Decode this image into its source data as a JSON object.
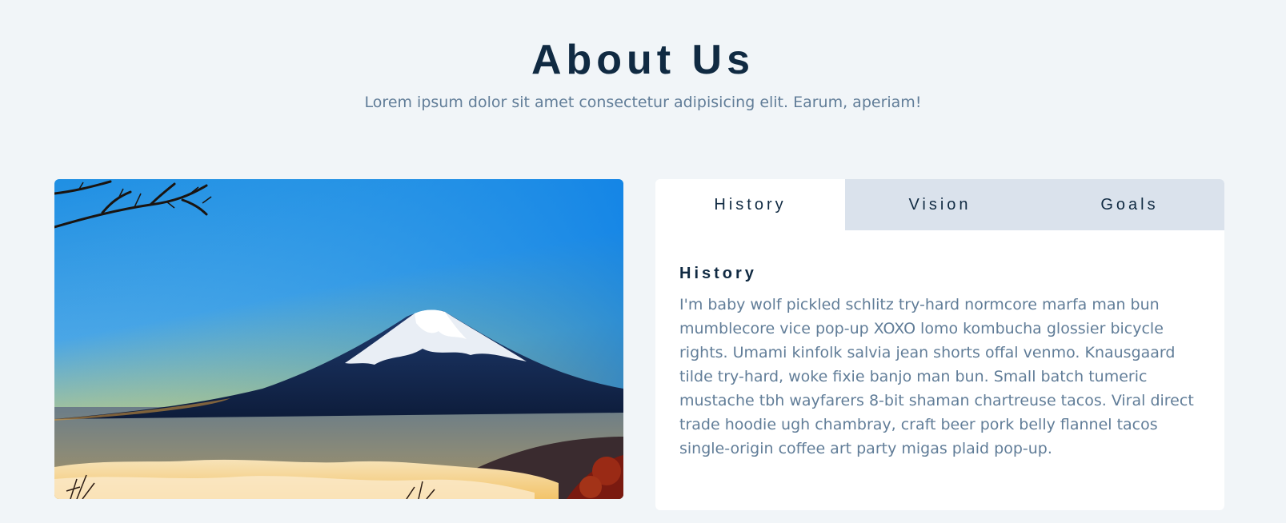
{
  "header": {
    "title": "About Us",
    "subtitle": "Lorem ipsum dolor sit amet consectetur adipisicing elit. Earum, aperiam!"
  },
  "image": {
    "alt_icon": "mountain-landscape-image"
  },
  "tabs": [
    {
      "label": "History",
      "active": true
    },
    {
      "label": "Vision",
      "active": false
    },
    {
      "label": "Goals",
      "active": false
    }
  ],
  "content": {
    "title": "History",
    "text": "I'm baby wolf pickled schlitz try-hard normcore marfa man bun mumblecore vice pop-up XOXO lomo kombucha glossier bicycle rights. Umami kinfolk salvia jean shorts offal venmo. Knausgaard tilde try-hard, woke fixie banjo man bun. Small batch tumeric mustache tbh wayfarers 8-bit shaman chartreuse tacos. Viral direct trade hoodie ugh chambray, craft beer pork belly flannel tacos single-origin coffee art party migas plaid pop-up."
  },
  "colors": {
    "background": "#f1f5f8",
    "title": "#102a42",
    "text": "#617d98",
    "tab_inactive": "#dae2ec",
    "tab_active": "#ffffff"
  }
}
